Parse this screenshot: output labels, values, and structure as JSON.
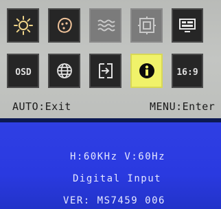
{
  "osd_menu": {
    "row1": [
      {
        "icon": "brightness-icon",
        "state": "normal"
      },
      {
        "icon": "contrast-face-icon",
        "state": "normal"
      },
      {
        "icon": "waves-icon",
        "state": "disabled"
      },
      {
        "icon": "position-icon",
        "state": "disabled"
      },
      {
        "icon": "monitor-settings-icon",
        "state": "normal"
      }
    ],
    "row2": [
      {
        "icon": "osd-icon",
        "state": "normal",
        "label": "OSD"
      },
      {
        "icon": "globe-icon",
        "state": "normal"
      },
      {
        "icon": "input-source-icon",
        "state": "normal"
      },
      {
        "icon": "information-icon",
        "state": "selected"
      },
      {
        "icon": "aspect-ratio-icon",
        "state": "normal",
        "label": "16:9"
      }
    ],
    "hints": {
      "left": "AUTO:Exit",
      "right": "MENU:Enter"
    }
  },
  "info_panel": {
    "frequency": "H:60KHz V:60Hz",
    "input": "Digital Input",
    "version": "VER: MS7459 006"
  },
  "colors": {
    "menu_background": "#bfc1be",
    "tile": "#262626",
    "tile_disabled": "#7b7b7b",
    "tile_selected": "#f0f26a",
    "info_background": "#2f3fe4",
    "info_text": "#e6e8ff"
  }
}
